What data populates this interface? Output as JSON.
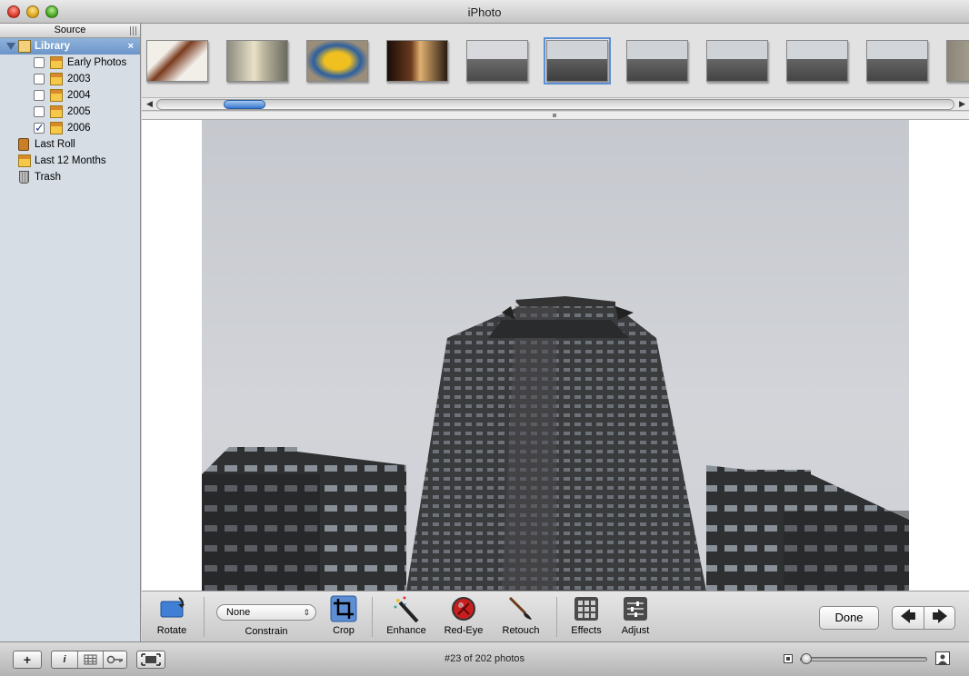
{
  "window": {
    "title": "iPhoto"
  },
  "sidebar": {
    "header": "Source",
    "library": {
      "label": "Library",
      "close": "×"
    },
    "folders": [
      {
        "label": "Early Photos",
        "checked": false
      },
      {
        "label": "2003",
        "checked": false
      },
      {
        "label": "2004",
        "checked": false
      },
      {
        "label": "2005",
        "checked": false
      },
      {
        "label": "2006",
        "checked": true
      }
    ],
    "items": [
      {
        "label": "Last Roll",
        "icon": "film-roll-icon"
      },
      {
        "label": "Last 12 Months",
        "icon": "calendar-icon"
      },
      {
        "label": "Trash",
        "icon": "trash-icon"
      }
    ]
  },
  "filmstrip": {
    "selected_index": 5,
    "count": 11
  },
  "toolbar": {
    "rotate": "Rotate",
    "constrain_value": "None",
    "constrain": "Constrain",
    "crop": "Crop",
    "enhance": "Enhance",
    "redeye": "Red-Eye",
    "retouch": "Retouch",
    "effects": "Effects",
    "adjust": "Adjust",
    "done": "Done",
    "prev": "🡄",
    "next": "🡆"
  },
  "bottombar": {
    "add": "+",
    "info": "i",
    "status": "#23 of 202 photos",
    "zoom_fraction": 0
  }
}
